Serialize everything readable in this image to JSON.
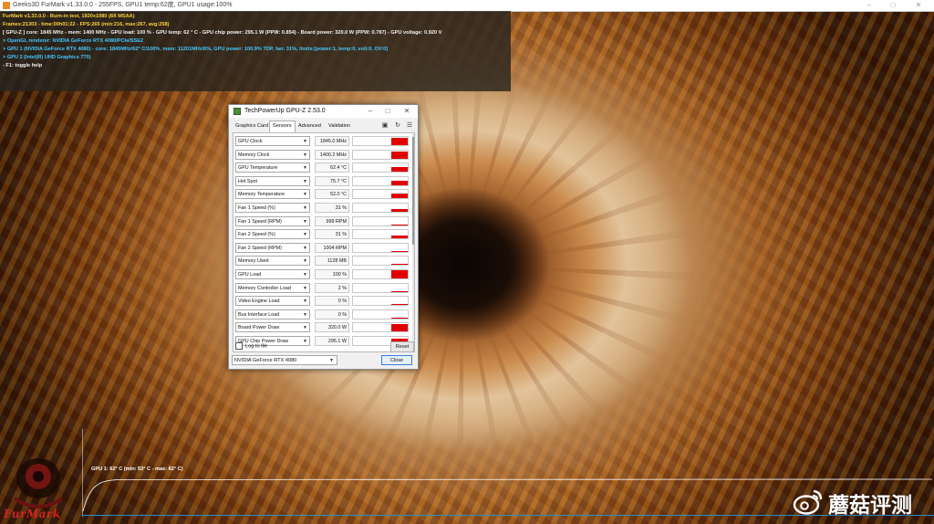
{
  "window": {
    "title": "Geeks3D FurMark v1.33.0.0 - 255FPS, GPU1 temp:62度, GPU1 usage:100%",
    "minimize_icon": "minimize-icon",
    "maximize_icon": "maximize-icon",
    "close_icon": "close-icon"
  },
  "osd": {
    "lines": [
      {
        "text": "FurMark v1.33.0.0 - Burn-in test, 1920x1080 (8X MSAA)",
        "color": "#ffd23c"
      },
      {
        "text": "Frames:21303 - time:00h01:22 - FPS:265 (min:216, max:267, avg:258)",
        "color": "#ffd23c"
      },
      {
        "text": "[ GPU-Z ] core: 1845 MHz - mem: 1400 MHz - GPU load: 100 % - GPU temp: 62 ° C - GPU chip power: 295.1 W (PPW: 0.854) - Board power: 320.0 W (PPW: 0.787) - GPU voltage: 0.920 V",
        "color": "#f2f2f2"
      },
      {
        "text": "> OpenGL renderer: NVIDIA GeForce RTX 4080/PCIe/SSE2",
        "color": "#43c8ff"
      },
      {
        "text": "> GPU 1 (NVIDIA GeForce RTX 4080) - core: 1845MHz/62° C/100%, mem: 11201MHz/6%, GPU power: 100.9% TDP, fan: 31%, limits:[power:1, temp:0, volt:0, OV:0]",
        "color": "#43c8ff"
      },
      {
        "text": "> GPU 2 (Intel(R) UHD Graphics 770)",
        "color": "#43c8ff"
      },
      {
        "text": "- F1: toggle help",
        "color": "#f2f2f2"
      }
    ]
  },
  "gpuz": {
    "title": "TechPowerUp GPU-Z 2.53.0",
    "tabs": [
      "Graphics Card",
      "Sensors",
      "Advanced",
      "Validation"
    ],
    "active_tab": "Sensors",
    "toolbar": {
      "camera_icon": "camera-icon",
      "refresh_icon": "refresh-icon",
      "menu_icon": "menu-icon"
    },
    "sensors": [
      {
        "label": "GPU Clock",
        "value": "1845.0 MHz",
        "level": 0.9
      },
      {
        "label": "Memory Clock",
        "value": "1400.2 MHz",
        "level": 0.85
      },
      {
        "label": "GPU Temperature",
        "value": "62.4 °C",
        "level": 0.55
      },
      {
        "label": "Hot Spot",
        "value": "75.7 °C",
        "level": 0.6
      },
      {
        "label": "Memory Temperature",
        "value": "52.0 °C",
        "level": 0.5
      },
      {
        "label": "Fan 1 Speed (%)",
        "value": "31 %",
        "level": 0.3
      },
      {
        "label": "Fan 1 Speed (RPM)",
        "value": "999 RPM",
        "level": 0.1
      },
      {
        "label": "Fan 2 Speed (%)",
        "value": "31 %",
        "level": 0.3
      },
      {
        "label": "Fan 2 Speed (RPM)",
        "value": "1004 RPM",
        "level": 0.1
      },
      {
        "label": "Memory Used",
        "value": "1128 MB",
        "level": 0.1
      },
      {
        "label": "GPU Load",
        "value": "100 %",
        "level": 1.0
      },
      {
        "label": "Memory Controller Load",
        "value": "2 %",
        "level": 0.0
      },
      {
        "label": "Video Engine Load",
        "value": "0 %",
        "level": 0.0
      },
      {
        "label": "Bus Interface Load",
        "value": "0 %",
        "level": 0.0
      },
      {
        "label": "Board Power Draw",
        "value": "320.0 W",
        "level": 0.85
      },
      {
        "label": "GPU Chip Power Draw",
        "value": "295.1 W",
        "level": 0.8
      }
    ],
    "log_to_file": "Log to file",
    "log_checked": false,
    "reset_label": "Reset",
    "gpu_select": "NVIDIA GeForce RTX 4080",
    "close_label": "Close"
  },
  "temp_graph": {
    "label": "GPU 1: 62° C (min: 53° C - max: 62° C)",
    "min_c": 53,
    "max_c": 62,
    "current_c": 62
  },
  "logos": {
    "furmark_logo": "furmark-logo",
    "furmark_text": "FurMark",
    "watermark_icon": "weibo-icon",
    "watermark_text": "蘑菇评测"
  },
  "colors": {
    "graph_bar": "#e00000",
    "osd_yellow": "#ffd23c",
    "osd_cyan": "#43c8ff",
    "accent_blue": "#3c7fd6"
  }
}
